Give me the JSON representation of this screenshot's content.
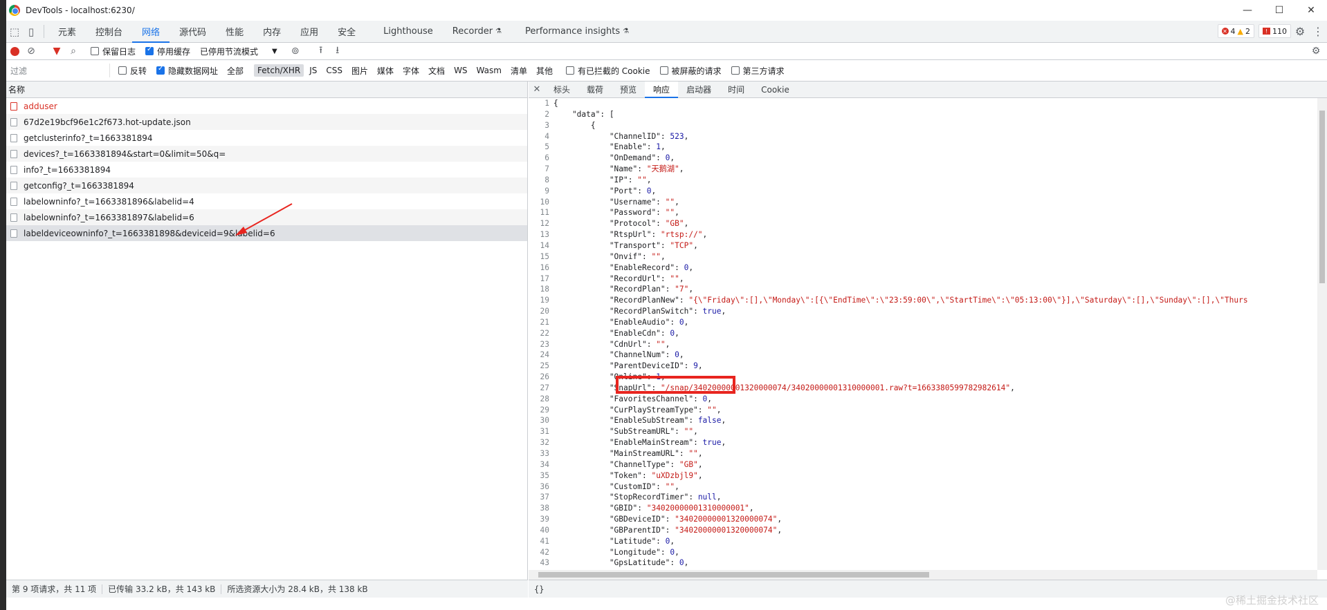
{
  "window": {
    "title": "DevTools - localhost:6230/",
    "minimize": "—",
    "maximize": "☐",
    "close": "✕"
  },
  "main_tabs": [
    "元素",
    "控制台",
    "网络",
    "源代码",
    "性能",
    "内存",
    "应用",
    "安全",
    "Lighthouse",
    "Recorder",
    "Performance insights"
  ],
  "badges": {
    "errors": "4",
    "warnings": "2",
    "issues": "110"
  },
  "toolbar": {
    "preserve_log": "保留日志",
    "disable_cache": "停用缓存",
    "throttle": "已停用节流模式"
  },
  "filter_bar": {
    "placeholder": "过滤",
    "invert": "反转",
    "hide_data_urls": "隐藏数据网址",
    "types": [
      "全部",
      "Fetch/XHR",
      "JS",
      "CSS",
      "图片",
      "媒体",
      "字体",
      "文档",
      "WS",
      "Wasm",
      "清单",
      "其他"
    ],
    "blocked_cookies": "有已拦截的 Cookie",
    "blocked_requests": "被屏蔽的请求",
    "third_party": "第三方请求"
  },
  "request_list": {
    "header": "名称",
    "rows": [
      "adduser",
      "67d2e19bcf96e1c2f673.hot-update.json",
      "getclusterinfo?_t=1663381894",
      "devices?_t=1663381894&start=0&limit=50&q=",
      "info?_t=1663381894",
      "getconfig?_t=1663381894",
      "labelowninfo?_t=1663381896&labelid=4",
      "labelowninfo?_t=1663381897&labelid=6",
      "labeldeviceowninfo?_t=1663381898&deviceid=9&labelid=6"
    ]
  },
  "status": {
    "requests": "第 9 项请求，共 11 项",
    "transferred": "已传输 33.2 kB，共 143 kB",
    "resources": "所选资源大小为 28.4 kB，共 138 kB"
  },
  "detail_tabs": [
    "标头",
    "载荷",
    "预览",
    "响应",
    "启动器",
    "时间",
    "Cookie"
  ],
  "response_lines": [
    "{",
    "    \"data\": [",
    "        {",
    "            \"ChannelID\": 523,",
    "            \"Enable\": 1,",
    "            \"OnDemand\": 0,",
    "            \"Name\": \"天鹅湖\",",
    "            \"IP\": \"\",",
    "            \"Port\": 0,",
    "            \"Username\": \"\",",
    "            \"Password\": \"\",",
    "            \"Protocol\": \"GB\",",
    "            \"RtspUrl\": \"rtsp://\",",
    "            \"Transport\": \"TCP\",",
    "            \"Onvif\": \"\",",
    "            \"EnableRecord\": 0,",
    "            \"RecordUrl\": \"\",",
    "            \"RecordPlan\": \"7\",",
    "            \"RecordPlanNew\": \"{\\\"Friday\\\":[],\\\"Monday\\\":[{\\\"EndTime\\\":\\\"23:59:00\\\",\\\"StartTime\\\":\\\"05:13:00\\\"}],\\\"Saturday\\\":[],\\\"Sunday\\\":[],\\\"Thurs",
    "            \"RecordPlanSwitch\": true,",
    "            \"EnableAudio\": 0,",
    "            \"EnableCdn\": 0,",
    "            \"CdnUrl\": \"\",",
    "            \"ChannelNum\": 0,",
    "            \"ParentDeviceID\": 9,",
    "            \"Online\": 1,",
    "            \"SnapUrl\": \"/snap/34020000001320000074/34020000001310000001.raw?t=1663380599782982614\",",
    "            \"FavoritesChannel\": 0,",
    "            \"CurPlayStreamType\": \"\",",
    "            \"EnableSubStream\": false,",
    "            \"SubStreamURL\": \"\",",
    "            \"EnableMainStream\": true,",
    "            \"MainStreamURL\": \"\",",
    "            \"ChannelType\": \"GB\",",
    "            \"Token\": \"uXDzbjl9\",",
    "            \"CustomID\": \"\",",
    "            \"StopRecordTimer\": null,",
    "            \"GBID\": \"34020000001310000001\",",
    "            \"GBDeviceID\": \"34020000001320000074\",",
    "            \"GBParentID\": \"34020000001320000074\",",
    "            \"Latitude\": 0,",
    "            \"Longitude\": 0,",
    "            \"GpsLatitude\": 0,"
  ],
  "format_button": "{}",
  "watermark": "@稀土掘金技术社区"
}
